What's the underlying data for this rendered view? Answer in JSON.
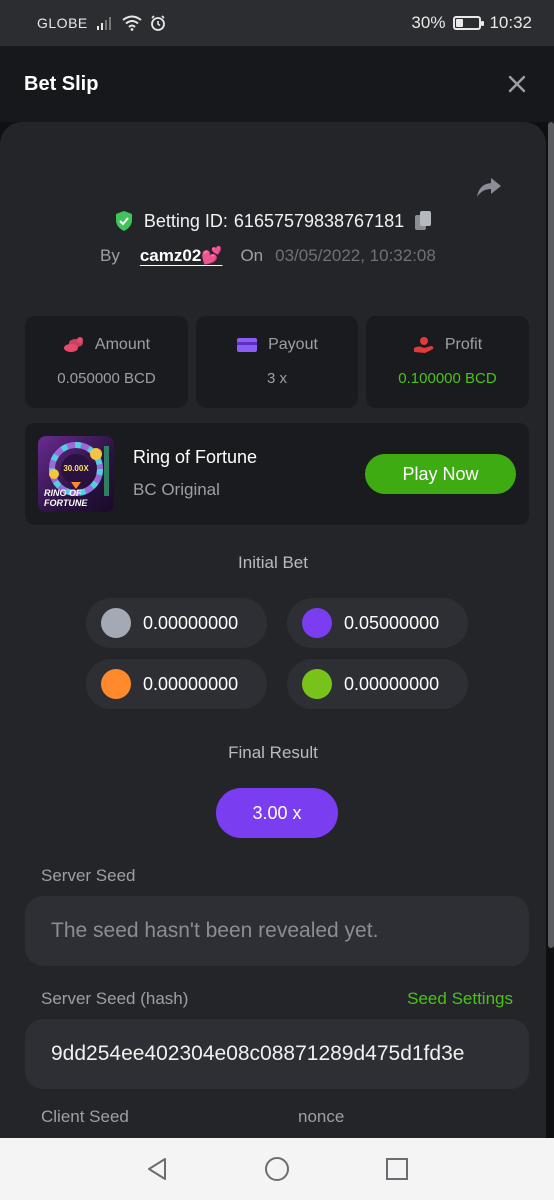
{
  "status_bar": {
    "carrier": "GLOBE",
    "battery_percent": "30%",
    "battery_level": 0.3,
    "time": "10:32"
  },
  "header": {
    "title": "Bet Slip"
  },
  "bet_info": {
    "betting_id_label": "Betting ID:",
    "betting_id": "61657579838767181",
    "by_label": "By",
    "username": "camz02💕",
    "on_label": "On",
    "datetime": "03/05/2022, 10:32:08"
  },
  "stats": [
    {
      "label": "Amount",
      "value": "0.050000 BCD",
      "icon": "coin-stack-icon",
      "color": "#e84a6b"
    },
    {
      "label": "Payout",
      "value": "3 x",
      "icon": "card-icon",
      "color": "#8b5cf6"
    },
    {
      "label": "Profit",
      "value": "0.100000 BCD",
      "icon": "hand-coin-icon",
      "color": "#e03a3a"
    }
  ],
  "game": {
    "name": "Ring of Fortune",
    "subtitle": "BC Original",
    "play_label": "Play Now",
    "thumb_logo_top": "RING OF",
    "thumb_logo_bottom": "FORTUNE",
    "thumb_multiplier": "30.00X"
  },
  "initial_bet": {
    "title": "Initial Bet",
    "bets": [
      {
        "value": "0.00000000",
        "color": "#a3aab3"
      },
      {
        "value": "0.05000000",
        "color": "#7b3df0"
      },
      {
        "value": "0.00000000",
        "color": "#ff8a2b"
      },
      {
        "value": "0.00000000",
        "color": "#78c31a"
      }
    ]
  },
  "final_result": {
    "title": "Final Result",
    "value": "3.00 x"
  },
  "seeds": {
    "server_seed_label": "Server Seed",
    "server_seed_placeholder": "The seed hasn't been revealed yet.",
    "server_hash_label": "Server Seed (hash)",
    "seed_settings_label": "Seed Settings",
    "server_hash_value": "9dd254ee402304e08c08871289d475d1fd3e",
    "client_seed_label": "Client Seed",
    "nonce_label": "nonce"
  },
  "colors": {
    "accent_green": "#4bc21a",
    "accent_purple": "#7b3df0",
    "verified_green": "#3fc35a"
  }
}
